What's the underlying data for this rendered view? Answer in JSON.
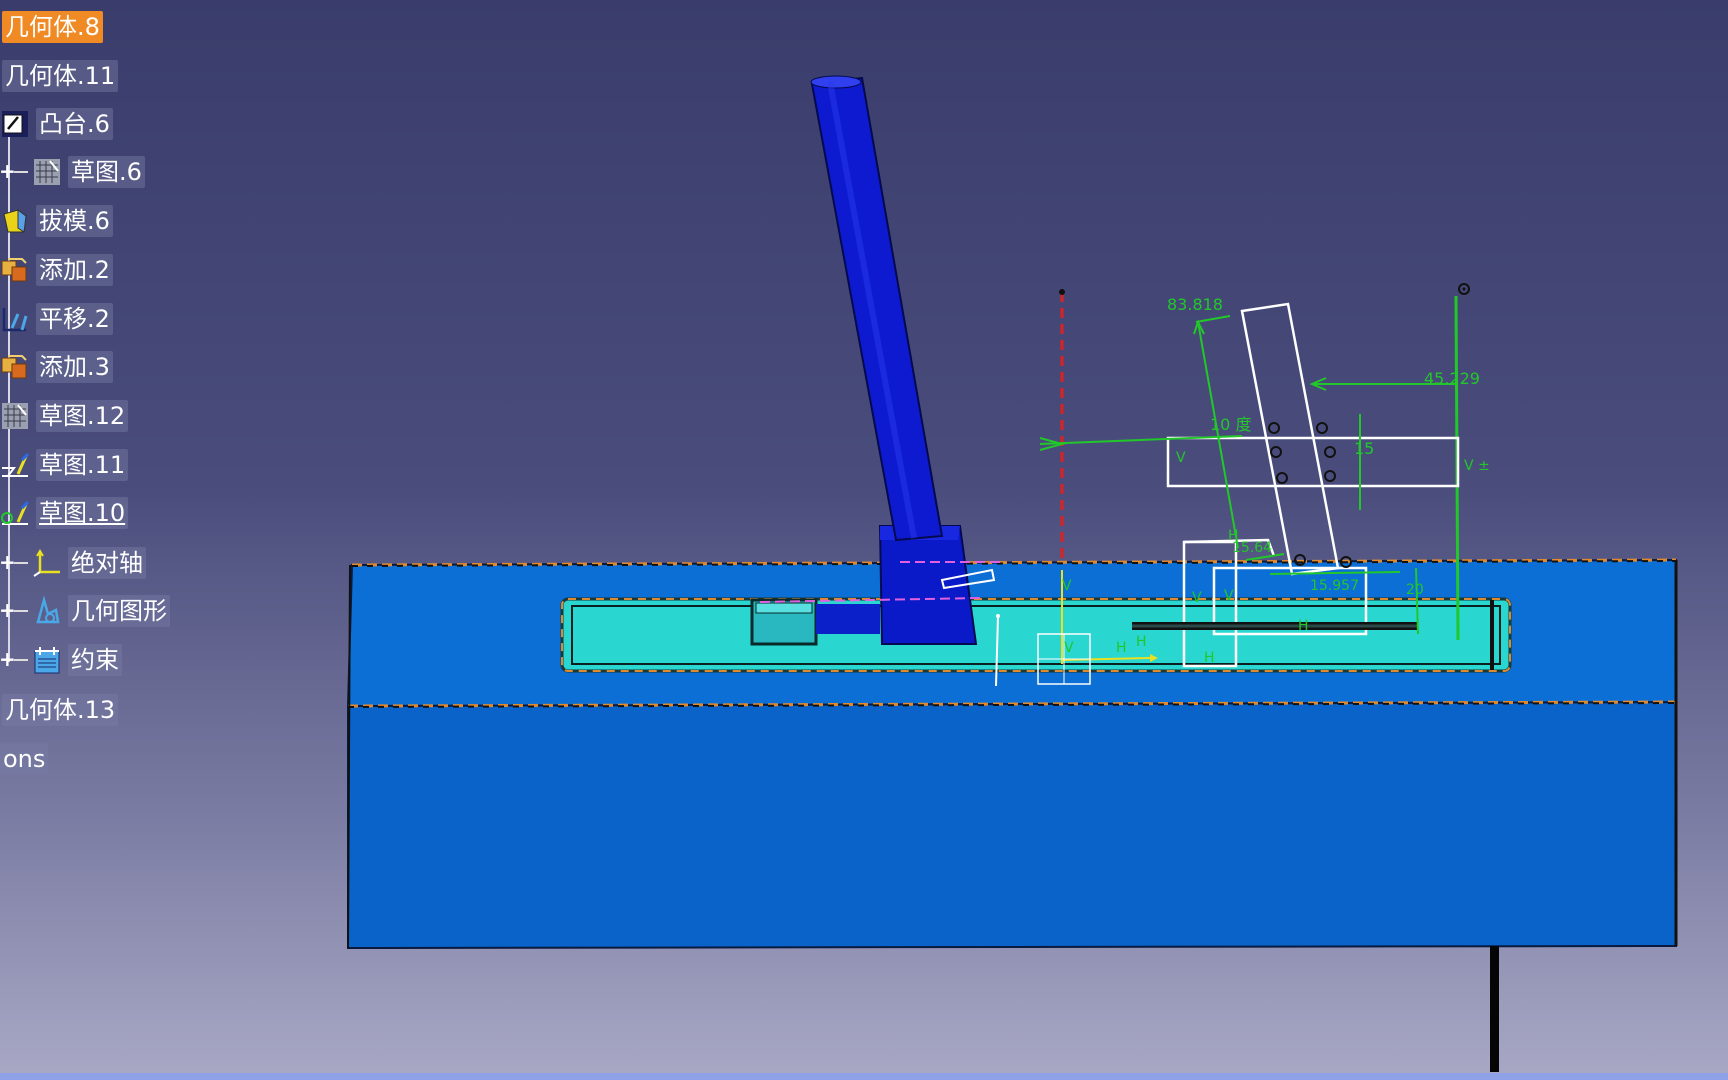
{
  "tree": {
    "items": [
      {
        "label": "几何体.8",
        "icon": "body-icon",
        "selected": true
      },
      {
        "label": "几何体.11",
        "icon": "body-icon"
      },
      {
        "label": "凸台.6",
        "icon": "pad-icon"
      },
      {
        "label": "草图.6",
        "icon": "sketch-icon",
        "expandable": true
      },
      {
        "label": "拔模.6",
        "icon": "draft-icon"
      },
      {
        "label": "添加.2",
        "icon": "add-icon"
      },
      {
        "label": "平移.2",
        "icon": "translate-icon"
      },
      {
        "label": "添加.3",
        "icon": "add-icon"
      },
      {
        "label": "草图.12",
        "icon": "sketch-icon"
      },
      {
        "label": "草图.11",
        "icon": "sketch-edit-icon"
      },
      {
        "label": "草图.10",
        "icon": "sketch-edit-icon",
        "underlined": true
      },
      {
        "label": "绝对轴",
        "icon": "axis-icon",
        "expandable": true
      },
      {
        "label": "几何图形",
        "icon": "geometry-icon",
        "expandable": true
      },
      {
        "label": "约束",
        "icon": "constraint-icon",
        "expandable": true
      },
      {
        "label": "几何体.13",
        "icon": "body-icon"
      },
      {
        "label": "ons",
        "icon": ""
      }
    ]
  },
  "dimensions": {
    "d1": "83.818",
    "d2": "45.229",
    "d3": "10 度",
    "d4": "15",
    "d5": "15.64",
    "d6": "15.957",
    "d7": "20"
  },
  "colors": {
    "selection": "#f08a24",
    "part_top": "#0a6fd8",
    "part_front": "#0a63c8",
    "slot": "#27d8d0",
    "rod": "#0d1ad0",
    "sketch_green": "#22c72a",
    "sketch_white": "#ffffff",
    "axis_red": "#e02020",
    "axis_yellow": "#e8e020"
  }
}
